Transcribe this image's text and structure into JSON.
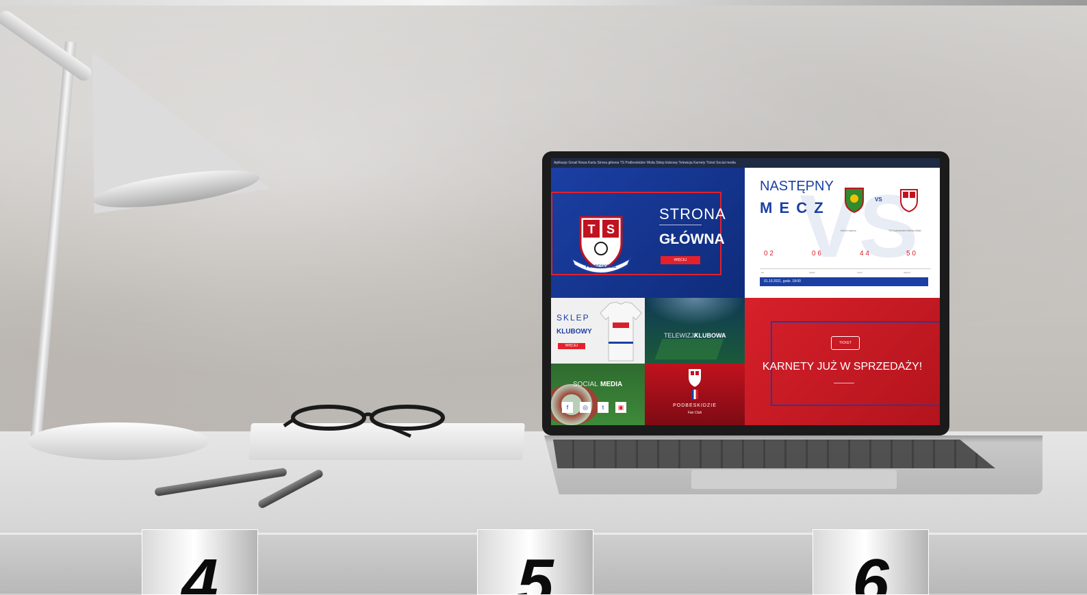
{
  "browser": {
    "tabs_text": "Aplikacje  Gmail  Nowa Karta  Strona główna  TS Podbeskidzie  Wisła  Sklep klubowy  Telewizja  Karnety  Ticket  Social media"
  },
  "screen": {
    "strona": {
      "line1": "STRONA",
      "line2": "GŁÓWNA",
      "button": "WIĘCEJ"
    },
    "mecz": {
      "title1": "NASTĘPNY",
      "title2": "M E C Z",
      "vs": "VS",
      "home_team": "Miedź Legnica",
      "away_team": "TS Podbeskidzie Bielsko-Biała",
      "countdown": [
        {
          "value": "0 2",
          "unit": "dni"
        },
        {
          "value": "0 6",
          "unit": "godzin"
        },
        {
          "value": "4 4",
          "unit": "minut"
        },
        {
          "value": "5 0",
          "unit": "sekund"
        }
      ],
      "date": "01.10.2021, godz. 18:00"
    },
    "sklep": {
      "line1": "SKLEP",
      "line2": "KLUBOWY",
      "button": "WIĘCEJ"
    },
    "telewizja": {
      "line1": "TELEWIZJA",
      "line2": "KLUBOWA"
    },
    "social": {
      "line1": "SOCIAL",
      "line2": "MEDIA",
      "icons": [
        "f",
        "◎",
        "t",
        "▣"
      ]
    },
    "podbeskidzie": {
      "name": "PODBESKIDZIE",
      "sub": "Fan Club"
    },
    "karnety": {
      "ticket": "TICKET",
      "text": "KARNETY JUŻ W SPRZEDAŻY!"
    },
    "crest": {
      "left": "T",
      "right": "S",
      "ribbon": "PODBESKIDZIE"
    }
  },
  "badges": [
    {
      "number": "4"
    },
    {
      "number": "5"
    },
    {
      "number": "6"
    }
  ],
  "colors": {
    "blue": "#1b3fa3",
    "red": "#d7202a",
    "white": "#ffffff"
  }
}
